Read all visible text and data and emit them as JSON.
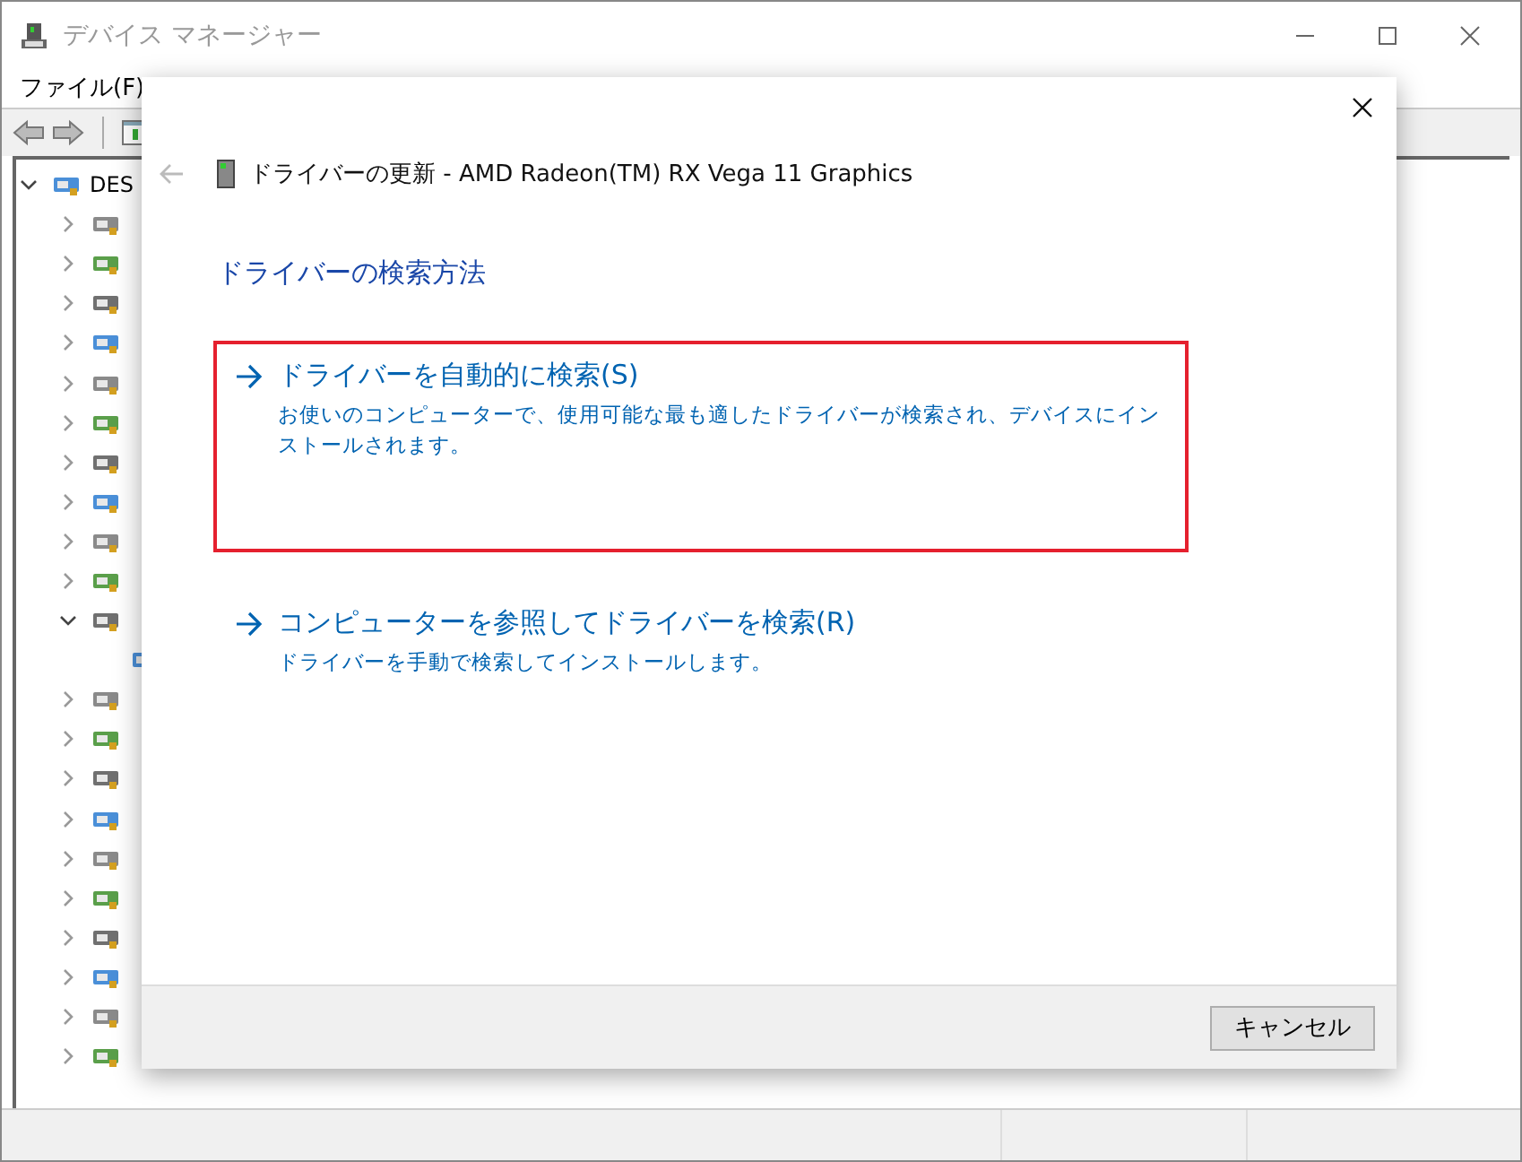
{
  "window": {
    "title": "デバイス マネージャー"
  },
  "menu": [
    {
      "label": "ファイル(F)"
    }
  ],
  "tree": [
    {
      "label": "DES",
      "expanded": true,
      "children": [
        {
          "expanded": false
        },
        {
          "expanded": false
        },
        {
          "expanded": false
        },
        {
          "expanded": false
        },
        {
          "expanded": false
        },
        {
          "expanded": false
        },
        {
          "expanded": false
        },
        {
          "expanded": false
        },
        {
          "expanded": false
        },
        {
          "expanded": false
        },
        {
          "expanded": true,
          "children": [
            {
              "kind": "leaf"
            }
          ]
        },
        {
          "expanded": false
        },
        {
          "expanded": false
        },
        {
          "expanded": false
        },
        {
          "expanded": false
        },
        {
          "expanded": false
        },
        {
          "expanded": false
        },
        {
          "expanded": false
        },
        {
          "expanded": false
        },
        {
          "expanded": false
        },
        {
          "expanded": false
        }
      ]
    }
  ],
  "dialog": {
    "title": "ドライバーの更新 - AMD Radeon(TM) RX Vega 11 Graphics",
    "heading": "ドライバーの検索方法",
    "options": [
      {
        "title": "ドライバーを自動的に検索(S)",
        "description": "お使いのコンピューターで、使用可能な最も適したドライバーが検索され、デバイスにインストールされます。",
        "selected": true
      },
      {
        "title": "コンピューターを参照してドライバーを検索(R)",
        "description": "ドライバーを手動で検索してインストールします。",
        "selected": false
      }
    ],
    "buttons": [
      "キャンセル"
    ]
  }
}
